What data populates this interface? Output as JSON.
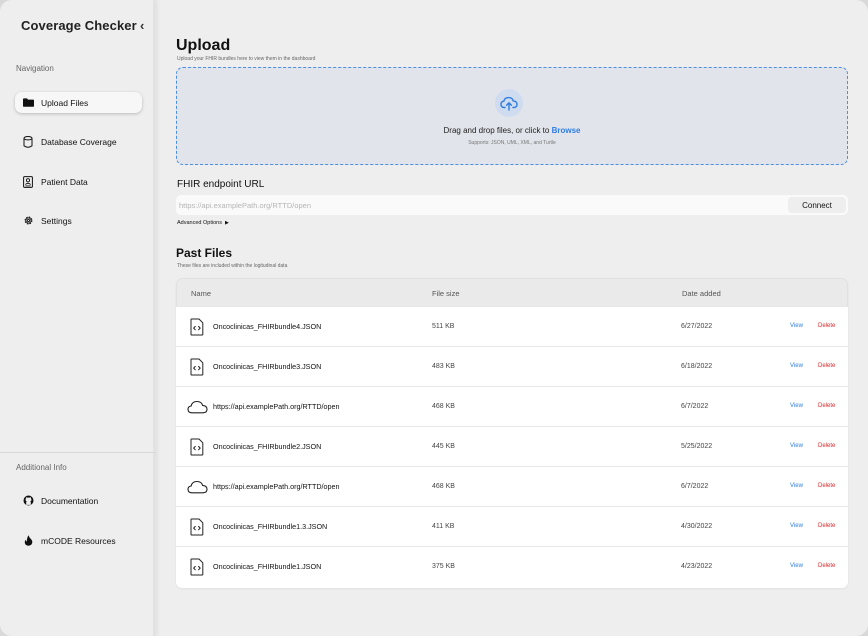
{
  "sidebar": {
    "app_title": "Coverage Checker",
    "collapse_icon": "chevron-left-icon",
    "navigation_label": "Navigation",
    "nav_items": [
      {
        "label": "Upload Files",
        "icon": "folder-icon",
        "active": true
      },
      {
        "label": "Database Coverage",
        "icon": "database-icon",
        "active": false
      },
      {
        "label": "Patient Data",
        "icon": "patient-card-icon",
        "active": false
      },
      {
        "label": "Settings",
        "icon": "gear-icon",
        "active": false
      }
    ],
    "additional_label": "Additional Info",
    "additional_items": [
      {
        "label": "Documentation",
        "icon": "github-icon"
      },
      {
        "label": "mCODE Resources",
        "icon": "flame-icon"
      }
    ]
  },
  "upload": {
    "title": "Upload",
    "subtitle": "Upload your FHIR bundles here to view them in the dashboard",
    "dropzone_text": "Drag and drop files, or click to ",
    "browse_label": "Browse",
    "supports_text": "Supports: JSON, UML, XML, and Turtle",
    "icon": "cloud-upload-icon"
  },
  "fhir": {
    "label": "FHIR endpoint URL",
    "placeholder": "https://api.examplePath.org/RTTD/open",
    "value": "",
    "connect_label": "Connect",
    "advanced_label": "Advanced Options"
  },
  "past_files": {
    "title": "Past Files",
    "subtitle": "These files are included within the logitudinal data",
    "columns": {
      "name": "Name",
      "size": "File size",
      "date": "Date added"
    },
    "view_label": "View",
    "delete_label": "Delete",
    "rows": [
      {
        "type": "file",
        "icon": "code-file-icon",
        "name": "Oncoclinicas_FHIRbundle4.JSON",
        "size": "511 KB",
        "date": "6/27/2022"
      },
      {
        "type": "file",
        "icon": "code-file-icon",
        "name": "Oncoclinicas_FHIRbundle3.JSON",
        "size": "483 KB",
        "date": "6/18/2022"
      },
      {
        "type": "cloud",
        "icon": "cloud-icon",
        "name": "https://api.examplePath.org/RTTD/open",
        "size": "468 KB",
        "date": "6/7/2022"
      },
      {
        "type": "file",
        "icon": "code-file-icon",
        "name": "Oncoclinicas_FHIRbundle2.JSON",
        "size": "445 KB",
        "date": "5/25/2022"
      },
      {
        "type": "cloud",
        "icon": "cloud-icon",
        "name": "https://api.examplePath.org/RTTD/open",
        "size": "468 KB",
        "date": "6/7/2022"
      },
      {
        "type": "file",
        "icon": "code-file-icon",
        "name": "Oncoclinicas_FHIRbundle1.3.JSON",
        "size": "411 KB",
        "date": "4/30/2022"
      },
      {
        "type": "file",
        "icon": "code-file-icon",
        "name": "Oncoclinicas_FHIRbundle1.JSON",
        "size": "375 KB",
        "date": "4/23/2022"
      }
    ]
  },
  "colors": {
    "accent": "#2f7de1",
    "danger": "#d92b2b",
    "dropzone_border": "#4a8ee6",
    "background": "#eeeeee"
  }
}
